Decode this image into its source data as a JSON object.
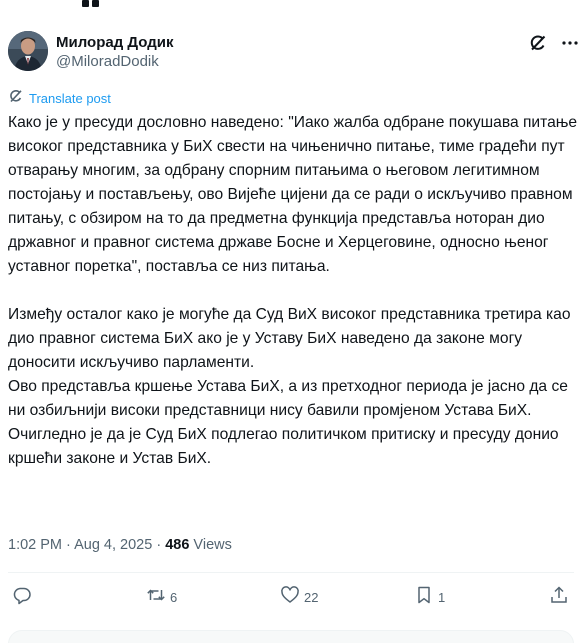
{
  "author": {
    "display_name": "Милорад Додик",
    "handle": "@MiloradDodik"
  },
  "translate_label": "Translate post",
  "post": {
    "paragraph1": "Како је у пресуди дословно наведено: \"Иако жалба одбране покушава питање високог представника у БиХ свести на чињенично питање, тиме градећи пут отварању многим, за одбрану спорним питањима о његовом легитимном постојању и постављењу, ово Вијеће цијени да се ради о искључиво правном питању, с обзиром на то да предметна функција представља ноторан дио државног и правног система државе Босне и Херцеговине, односно њеног уставног поретка\", поставља се низ питања.",
    "paragraph2": "Између осталог како је могуће да Суд ВиХ високог представника третира као дио правног система БиХ ако је у Уставу БиХ наведено да законе могу доносити искључиво парламенти.\nОво представља кршење Устава БиХ, а из претходног периода је јасно да се ни озбиљнији високи представници нису бавили промјеном Устава БиХ.\nОчигледно је да је Суд БиХ подлегао политичком притиску и пресуду донио кршећи законе и Устав БиХ."
  },
  "meta": {
    "time": "1:02 PM",
    "separator": " · ",
    "date": "Aug 4, 2025",
    "views_count": "486",
    "views_label": " Views"
  },
  "actions": {
    "replies": "",
    "reposts": "6",
    "likes": "22",
    "bookmarks": "1"
  },
  "colors": {
    "accent": "#1d9bf0",
    "secondary_text": "#536471",
    "primary_text": "#0f1419"
  },
  "icons": [
    "grok-icon",
    "more-icon",
    "translate-icon",
    "reply-icon",
    "repost-icon",
    "like-icon",
    "bookmark-icon",
    "share-icon"
  ]
}
